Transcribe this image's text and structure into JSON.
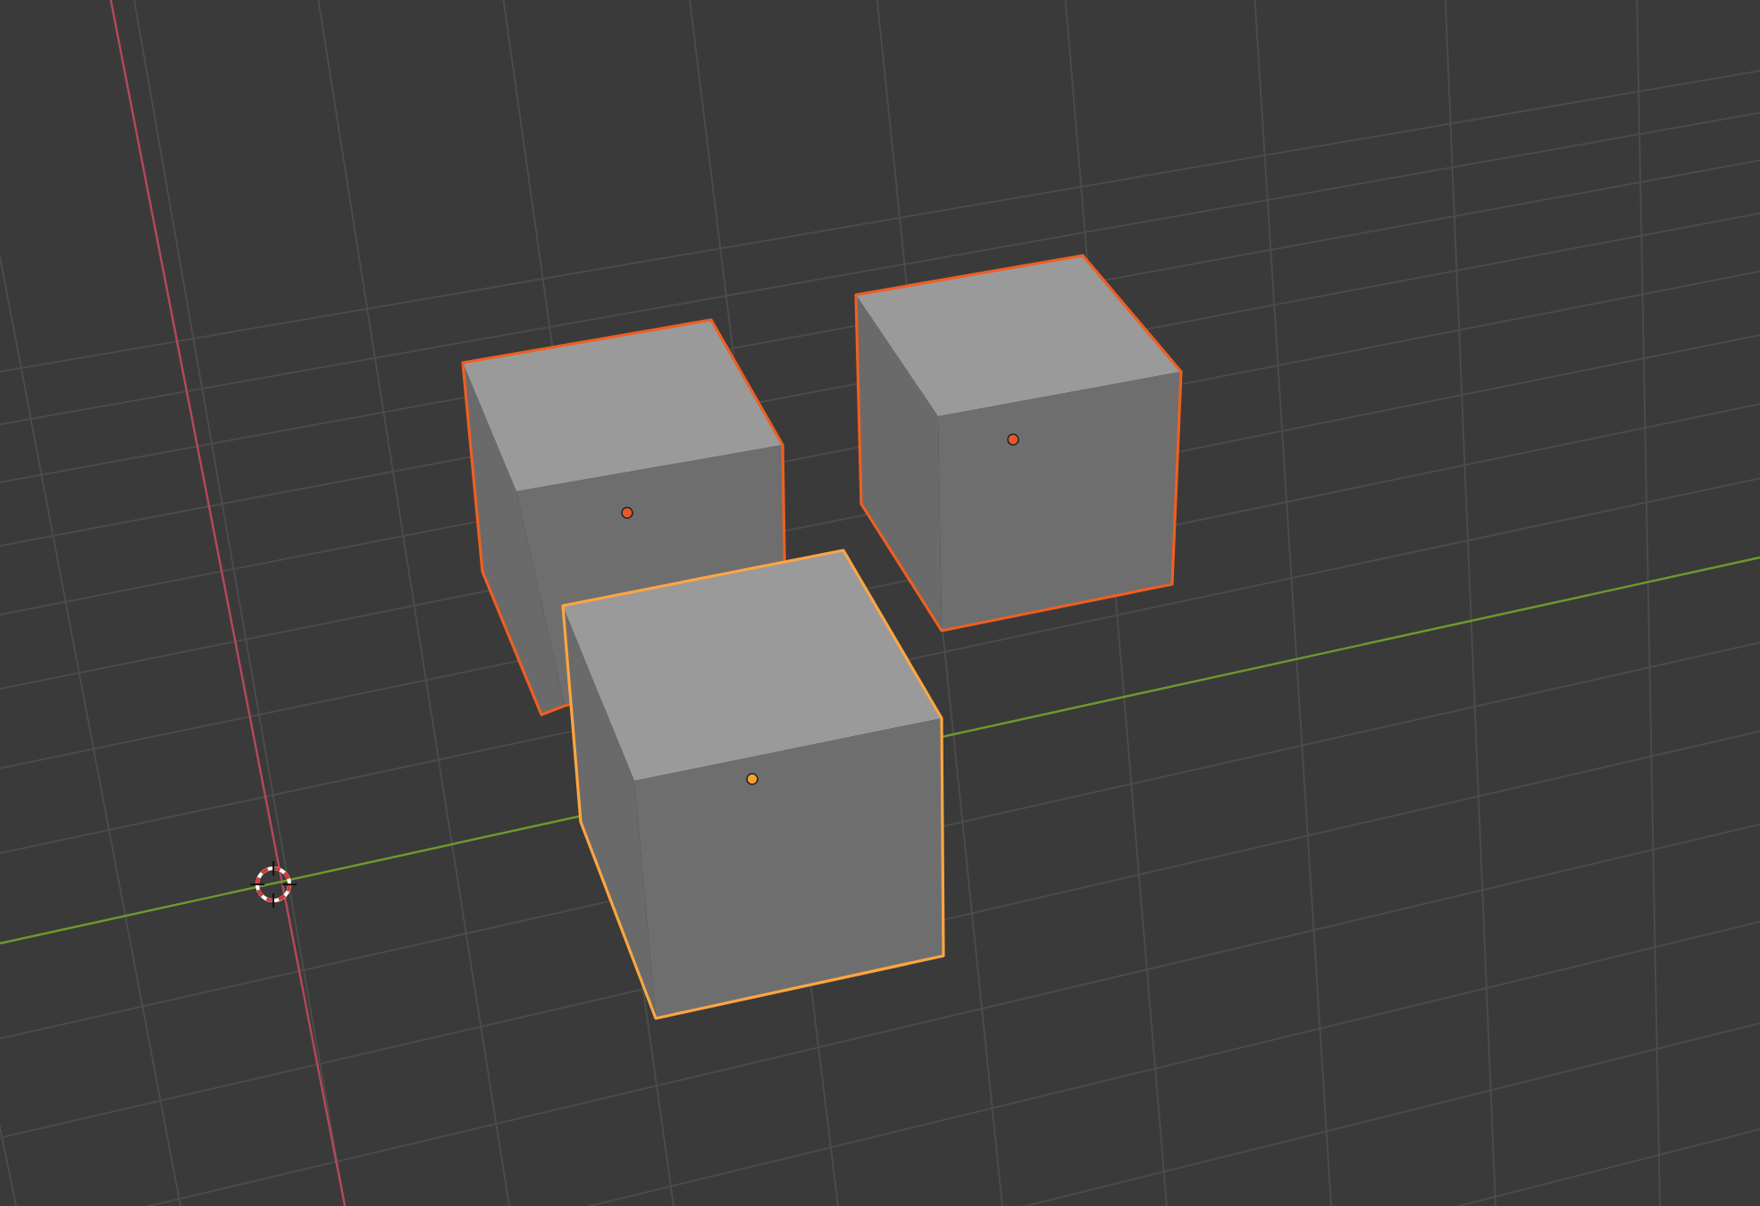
{
  "viewport": {
    "objects": [
      {
        "kind": "cube",
        "selected": true,
        "active": false
      },
      {
        "kind": "cube",
        "selected": true,
        "active": false
      },
      {
        "kind": "cube",
        "selected": true,
        "active": true
      }
    ],
    "show_cursor": true
  }
}
